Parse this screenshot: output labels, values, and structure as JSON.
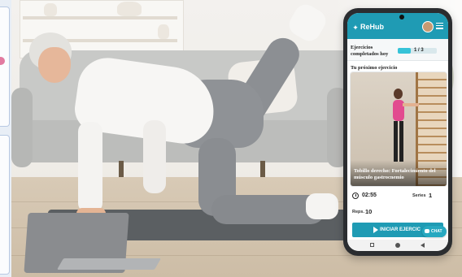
{
  "app": {
    "name": "ReHub",
    "logo_icon": "rehub-logo-icon",
    "accent_color": "#1f9bb4"
  },
  "progress": {
    "label": "Ejercicios completados hoy",
    "count": "1 / 3",
    "fraction": 0.33
  },
  "next_exercise": {
    "section_title": "Tu próximo ejercicio",
    "name": "Tobillo derecho: Fortalecimiento del músculo gastrocnemio",
    "time": "02:55",
    "sets_label": "Series",
    "sets_value": "1",
    "reps_label": "Reps.",
    "reps_value": "10"
  },
  "actions": {
    "start_label": "INICIAR EJERCIC",
    "chat_label": "CHAT"
  }
}
